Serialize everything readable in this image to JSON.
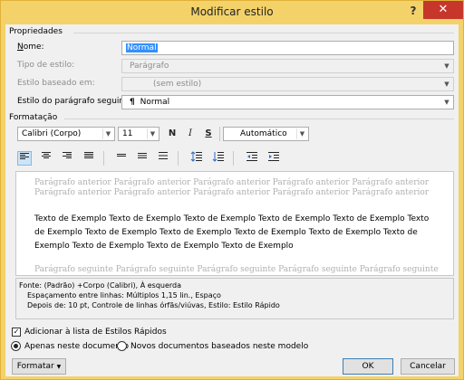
{
  "window": {
    "title": "Modificar estilo",
    "help": "?",
    "close": "✕"
  },
  "properties": {
    "section": "Propriedades",
    "name_label": "Nome:",
    "name_value": "Normal",
    "type_label": "Tipo de estilo:",
    "type_value": "Parágrafo",
    "based_label": "Estilo baseado em:",
    "based_value": "(sem estilo)",
    "next_label": "Estilo do parágrafo seguinte:",
    "next_value": "Normal",
    "next_icon": "¶"
  },
  "formatting": {
    "section": "Formatação",
    "font": "Calibri (Corpo)",
    "size": "11",
    "bold": "N",
    "italic": "I",
    "underline": "S",
    "color": "Automático"
  },
  "preview": {
    "before": "Parágrafo anterior Parágrafo anterior Parágrafo anterior Parágrafo anterior Parágrafo anterior Parágrafo anterior Parágrafo anterior Parágrafo anterior Parágrafo anterior Parágrafo anterior",
    "sample": "Texto de Exemplo Texto de Exemplo Texto de Exemplo Texto de Exemplo Texto de Exemplo Texto de Exemplo Texto de Exemplo Texto de Exemplo Texto de Exemplo Texto de Exemplo Texto de Exemplo Texto de Exemplo Texto de Exemplo Texto de Exemplo",
    "after": "Parágrafo seguinte Parágrafo seguinte Parágrafo seguinte Parágrafo seguinte Parágrafo seguinte"
  },
  "description": {
    "line1": "Fonte: (Padrão) +Corpo (Calibri), À esquerda",
    "line2": "Espaçamento entre linhas:  Múltiplos 1,15 lin., Espaço",
    "line3": "Depois de:  10 pt, Controle de linhas órfãs/viúvas, Estilo: Estilo Rápido"
  },
  "options": {
    "add_quick": "Adicionar à lista de Estilos Rápidos",
    "only_doc": "Apenas neste documento",
    "new_docs": "Novos documentos baseados neste modelo"
  },
  "buttons": {
    "format": "Formatar",
    "ok": "OK",
    "cancel": "Cancelar"
  }
}
